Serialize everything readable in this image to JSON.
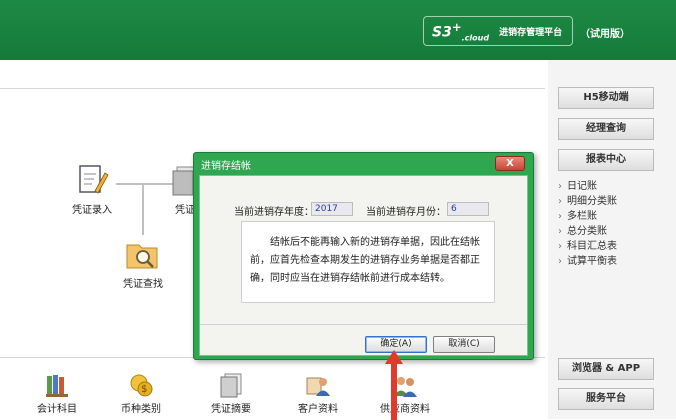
{
  "header": {
    "brand_logo": "S3",
    "brand_logo_sup": "+",
    "brand_logo_sub": ".cloud",
    "brand_title": "进销存管理平台",
    "edition": "（试用版）"
  },
  "workspace": {
    "flow": {
      "voucher_entry": "凭证录入",
      "voucher_partial": "凭证",
      "voucher_search": "凭证查找"
    }
  },
  "sidebar": {
    "buttons": {
      "h5_mobile": "H5移动端",
      "manager_query": "经理查询",
      "report_center": "报表中心",
      "browser_app": "浏览器 & APP",
      "service_platform": "服务平台"
    },
    "reports": [
      "日记账",
      "明细分类账",
      "多栏账",
      "总分类账",
      "科目汇总表",
      "试算平衡表"
    ]
  },
  "bottombar": {
    "tools": [
      "会计科目",
      "币种类别",
      "凭证摘要",
      "客户资料",
      "供应商资料"
    ]
  },
  "dialog": {
    "title": "进销存结帐",
    "close": "X",
    "year_label": "当前进销存年度：",
    "year_value": "2017",
    "month_label": "当前进销存月份：",
    "month_value": "6",
    "notice": "结帐后不能再输入新的进销存单据，因此在结帐前，应首先检查本期发生的进销存业务单据是否都正确，同时应当在进销存结帐前进行成本结转。",
    "ok_button": "确定(A)",
    "cancel_button": "取消(C)"
  },
  "colors": {
    "header_green": "#1e8a45",
    "dialog_green": "#2fa650",
    "close_red": "#c8443a",
    "arrow_red": "#e03a2a"
  }
}
